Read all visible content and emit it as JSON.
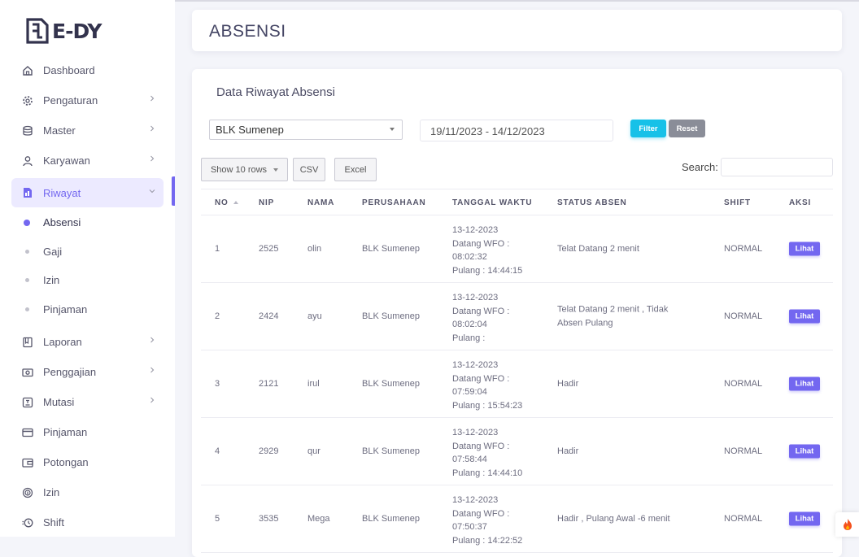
{
  "brand": {
    "name": "E-DY"
  },
  "sidebar": {
    "items": [
      {
        "label": "Dashboard",
        "icon": "home-icon"
      },
      {
        "label": "Pengaturan",
        "icon": "gear-icon"
      },
      {
        "label": "Master",
        "icon": "database-icon"
      },
      {
        "label": "Karyawan",
        "icon": "user-icon"
      },
      {
        "label": "Riwayat",
        "icon": "file-icon",
        "active": true
      },
      {
        "label": "Laporan",
        "icon": "book-icon"
      },
      {
        "label": "Penggajian",
        "icon": "money-icon"
      },
      {
        "label": "Mutasi",
        "icon": "transfer-icon"
      },
      {
        "label": "Pinjaman",
        "icon": "credit-card-icon"
      },
      {
        "label": "Potongan",
        "icon": "wallet-icon"
      },
      {
        "label": "Izin",
        "icon": "fingerprint-icon"
      },
      {
        "label": "Shift",
        "icon": "clock-icon"
      }
    ],
    "riwayat_sub": [
      {
        "label": "Absensi",
        "current": true
      },
      {
        "label": "Gaji"
      },
      {
        "label": "Izin"
      },
      {
        "label": "Pinjaman"
      }
    ]
  },
  "header": {
    "title": "ABSENSI"
  },
  "card": {
    "title": "Data Riwayat Absensi"
  },
  "filters": {
    "company": "BLK Sumenep",
    "date_range": "19/11/2023 - 14/12/2023",
    "filter_label": "Filter",
    "reset_label": "Reset"
  },
  "toolbar": {
    "show_rows": "Show 10 rows",
    "csv": "CSV",
    "excel": "Excel",
    "search_label": "Search:"
  },
  "table": {
    "columns": [
      "NO",
      "NIP",
      "NAMA",
      "PERUSAHAAN",
      "TANGGAL WAKTU",
      "STATUS ABSEN",
      "SHIFT",
      "AKSI"
    ],
    "rows": [
      {
        "no": "1",
        "nip": "2525",
        "nama": "olin",
        "perusahaan": "BLK Sumenep",
        "tanggal": "13-12-2023",
        "datang_label": "Datang WFO :",
        "datang": "08:02:32",
        "pulang": "Pulang : 14:44:15",
        "status": "Telat Datang 2 menit",
        "status2": "",
        "shift": "NORMAL",
        "aksi": "Lihat"
      },
      {
        "no": "2",
        "nip": "2424",
        "nama": "ayu",
        "perusahaan": "BLK Sumenep",
        "tanggal": "13-12-2023",
        "datang_label": "Datang WFO :",
        "datang": "08:02:04",
        "pulang": "Pulang :",
        "status": "Telat Datang 2 menit , Tidak",
        "status2": "Absen Pulang",
        "shift": "NORMAL",
        "aksi": "Lihat"
      },
      {
        "no": "3",
        "nip": "2121",
        "nama": "irul",
        "perusahaan": "BLK Sumenep",
        "tanggal": "13-12-2023",
        "datang_label": "Datang WFO :",
        "datang": "07:59:04",
        "pulang": "Pulang : 15:54:23",
        "status": "Hadir",
        "status2": "",
        "shift": "NORMAL",
        "aksi": "Lihat"
      },
      {
        "no": "4",
        "nip": "2929",
        "nama": "qur",
        "perusahaan": "BLK Sumenep",
        "tanggal": "13-12-2023",
        "datang_label": "Datang WFO :",
        "datang": "07:58:44",
        "pulang": "Pulang : 14:44:10",
        "status": "Hadir",
        "status2": "",
        "shift": "NORMAL",
        "aksi": "Lihat"
      },
      {
        "no": "5",
        "nip": "3535",
        "nama": "Mega",
        "perusahaan": "BLK Sumenep",
        "tanggal": "13-12-2023",
        "datang_label": "Datang WFO :",
        "datang": "07:50:37",
        "pulang": "Pulang : 14:22:52",
        "status": "Hadir , Pulang Awal -6 menit",
        "status2": "",
        "shift": "NORMAL",
        "aksi": "Lihat"
      }
    ]
  },
  "colors": {
    "primary": "#7367f0",
    "info": "#17c1e8",
    "secondary": "#8a8d98"
  }
}
